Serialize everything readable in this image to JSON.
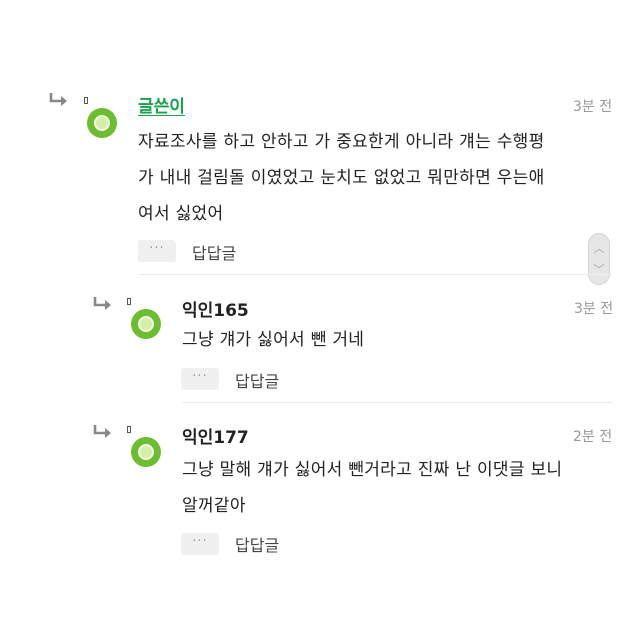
{
  "comments": [
    {
      "author": "글쓴이",
      "time": "3분 전",
      "lines": [
        "자료조사를 하고 안하고 가 중요한게 아니라 걔는 수행평",
        "가 내내 걸림돌 이였었고 눈치도 없었고 뭐만하면 우는애",
        "여서 싫었어"
      ],
      "more_label": "···",
      "reply_label": "답답글",
      "avatar_icon": "kiwi-avatar-icon",
      "reply_icon": "reply-arrow-icon"
    },
    {
      "author": "익인165",
      "time": "3분 전",
      "lines": [
        "그냥 걔가 싫어서 뺀 거네"
      ],
      "more_label": "···",
      "reply_label": "답답글",
      "avatar_icon": "kiwi-avatar-icon",
      "reply_icon": "reply-arrow-icon"
    },
    {
      "author": "익인177",
      "time": "2분 전",
      "lines": [
        "그냥 말해 걔가 싫어서 뺀거라고 진짜 난 이댓글 보니",
        "알꺼같아"
      ],
      "more_label": "···",
      "reply_label": "답답글",
      "avatar_icon": "kiwi-avatar-icon",
      "reply_icon": "reply-arrow-icon"
    }
  ],
  "scroll": {
    "up_icon": "chevron-up-icon",
    "down_icon": "chevron-down-icon"
  },
  "colors": {
    "author_name": "#16a34a",
    "avatar": "#6cbd30",
    "time": "#999999"
  }
}
